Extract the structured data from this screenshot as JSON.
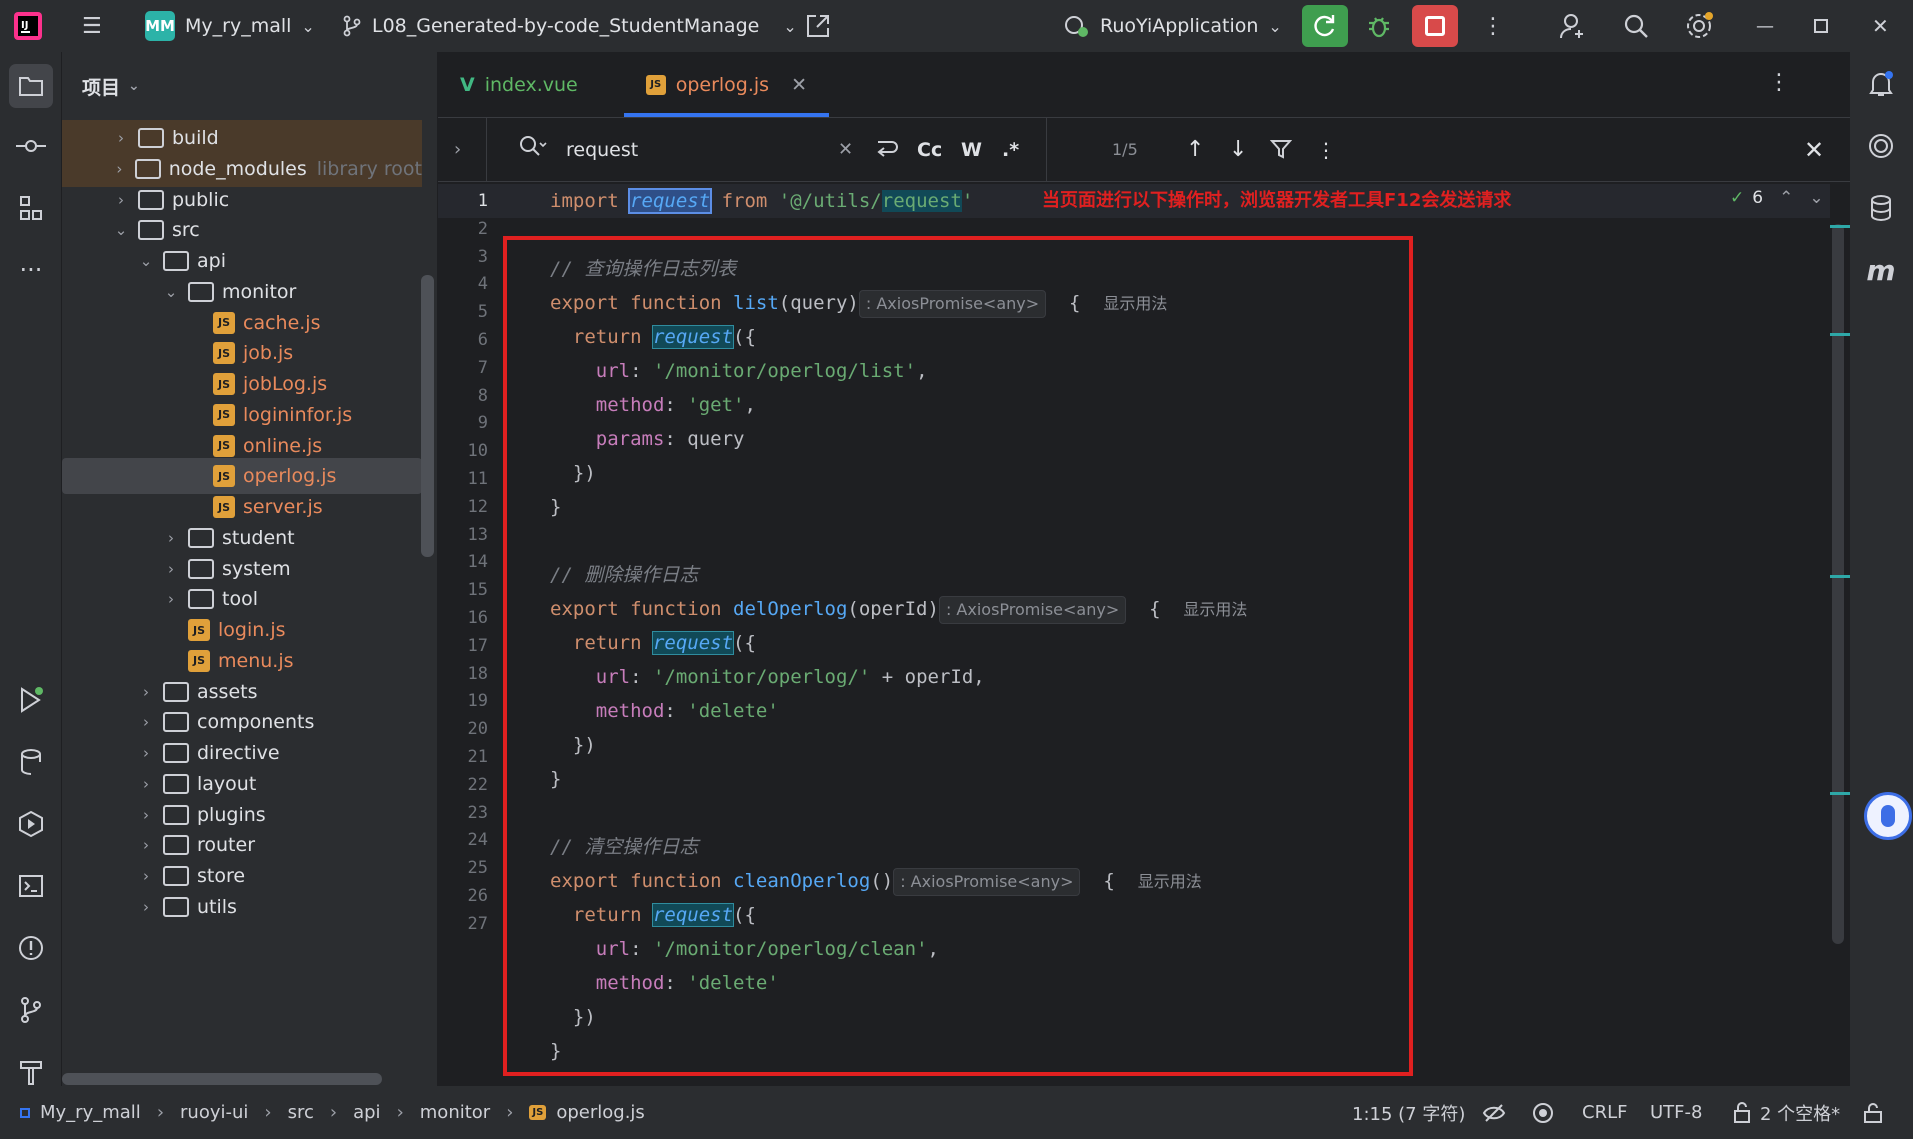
{
  "titlebar": {
    "project_badge": "MM",
    "project_name": "My_ry_mall",
    "branch": "L08_Generated-by-code_StudentManage",
    "run_config": "RuoYiApplication"
  },
  "project_panel": {
    "title": "项目",
    "tree": [
      {
        "label": "build",
        "type": "folder",
        "depth": 2,
        "expanded": false
      },
      {
        "label": "node_modules",
        "hint": "library root",
        "type": "folder",
        "depth": 2,
        "expanded": false
      },
      {
        "label": "public",
        "type": "folder",
        "depth": 2,
        "expanded": false
      },
      {
        "label": "src",
        "type": "folder",
        "depth": 2,
        "expanded": true
      },
      {
        "label": "api",
        "type": "folder",
        "depth": 3,
        "expanded": true
      },
      {
        "label": "monitor",
        "type": "folder",
        "depth": 4,
        "expanded": true
      },
      {
        "label": "cache.js",
        "type": "js",
        "depth": 5
      },
      {
        "label": "job.js",
        "type": "js",
        "depth": 5
      },
      {
        "label": "jobLog.js",
        "type": "js",
        "depth": 5
      },
      {
        "label": "logininfor.js",
        "type": "js",
        "depth": 5
      },
      {
        "label": "online.js",
        "type": "js",
        "depth": 5
      },
      {
        "label": "operlog.js",
        "type": "js",
        "depth": 5,
        "selected": true
      },
      {
        "label": "server.js",
        "type": "js",
        "depth": 5
      },
      {
        "label": "student",
        "type": "folder",
        "depth": 4,
        "expanded": false
      },
      {
        "label": "system",
        "type": "folder",
        "depth": 4,
        "expanded": false
      },
      {
        "label": "tool",
        "type": "folder",
        "depth": 4,
        "expanded": false
      },
      {
        "label": "login.js",
        "type": "js",
        "depth": 4
      },
      {
        "label": "menu.js",
        "type": "js",
        "depth": 4
      },
      {
        "label": "assets",
        "type": "folder",
        "depth": 3,
        "expanded": false
      },
      {
        "label": "components",
        "type": "folder",
        "depth": 3,
        "expanded": false
      },
      {
        "label": "directive",
        "type": "folder",
        "depth": 3,
        "expanded": false
      },
      {
        "label": "layout",
        "type": "folder",
        "depth": 3,
        "expanded": false
      },
      {
        "label": "plugins",
        "type": "folder",
        "depth": 3,
        "expanded": false
      },
      {
        "label": "router",
        "type": "folder",
        "depth": 3,
        "expanded": false
      },
      {
        "label": "store",
        "type": "folder",
        "depth": 3,
        "expanded": false
      },
      {
        "label": "utils",
        "type": "folder",
        "depth": 3,
        "expanded": false
      }
    ]
  },
  "tabs": [
    {
      "label": "index.vue",
      "icon": "vue-icon",
      "active": false
    },
    {
      "label": "operlog.js",
      "icon": "js-icon",
      "active": true
    }
  ],
  "find": {
    "query": "request",
    "count": "1/5",
    "opt_case": "Cc",
    "opt_word": "W",
    "opt_regex": ".*"
  },
  "editor": {
    "inspection_count": "6",
    "annotation": "当页面进行以下操作时，浏览器开发者工具F12会发送请求",
    "type_hint": ": AxiosPromise<any>",
    "usage_hint": "显示用法",
    "comments": {
      "c3": "// 查询操作日志列表",
      "c12": "// 删除操作日志",
      "c20": "// 清空操作日志"
    },
    "line_numbers": [
      "1",
      "2",
      "3",
      "4",
      "5",
      "6",
      "7",
      "8",
      "9",
      "10",
      "11",
      "12",
      "13",
      "14",
      "15",
      "16",
      "17",
      "18",
      "19",
      "20",
      "21",
      "22",
      "23",
      "24",
      "25",
      "26",
      "27"
    ]
  },
  "statusbar": {
    "breadcrumb": [
      "My_ry_mall",
      "ruoyi-ui",
      "src",
      "api",
      "monitor",
      "operlog.js"
    ],
    "position": "1:15 (7 字符)",
    "line_sep": "CRLF",
    "encoding": "UTF-8",
    "indent": "2 个空格*"
  },
  "colors": {
    "highlight_box": "#e02020",
    "accent": "#3574f0",
    "annotation_text": "#e02020"
  }
}
